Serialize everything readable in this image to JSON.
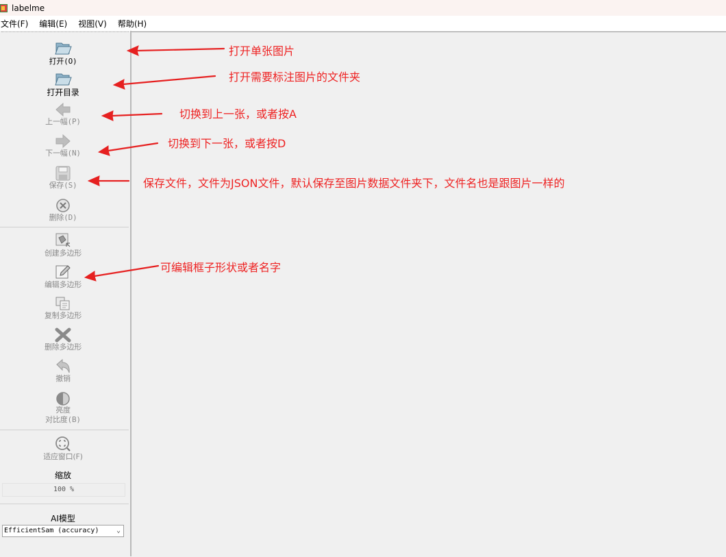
{
  "window": {
    "title": "labelme"
  },
  "menu": [
    {
      "label": "文件(F)"
    },
    {
      "label": "编辑(E)"
    },
    {
      "label": "视图(V)"
    },
    {
      "label": "帮助(H)"
    }
  ],
  "toolbar": {
    "open": {
      "label": "打开(O)",
      "icon": "folder-open-icon",
      "enabled": true
    },
    "open_dir": {
      "label": "打开目录",
      "icon": "folder-open-icon",
      "enabled": true
    },
    "prev": {
      "label": "上一幅(P)",
      "icon": "arrow-left-icon",
      "enabled": false
    },
    "next": {
      "label": "下一幅(N)",
      "icon": "arrow-right-icon",
      "enabled": false
    },
    "save": {
      "label": "保存(S)",
      "icon": "floppy-disk-icon",
      "enabled": false
    },
    "delete": {
      "label": "删除(D)",
      "icon": "circle-x-icon",
      "enabled": false
    },
    "create_polygon": {
      "label": "创建多边形",
      "icon": "polygon-create-icon",
      "enabled": false
    },
    "edit_polygon": {
      "label": "编辑多边形",
      "icon": "pencil-edit-icon",
      "enabled": false
    },
    "copy_polygon": {
      "label": "复制多边形",
      "icon": "copy-icon",
      "enabled": false
    },
    "delete_polygon": {
      "label": "删除多边形",
      "icon": "cross-delete-icon",
      "enabled": false
    },
    "undo": {
      "label": "撤销",
      "icon": "undo-icon",
      "enabled": false
    },
    "brightness": {
      "label_line1": "亮度",
      "label_line2": "对比度(B)",
      "icon": "brightness-icon",
      "enabled": false
    },
    "fit_window": {
      "label": "适应窗口(F)",
      "icon": "zoom-fit-icon",
      "enabled": false
    },
    "zoom": {
      "title": "缩放",
      "value": "100 %"
    },
    "ai_model": {
      "title": "AI模型",
      "selected": "EfficientSam (accuracy)"
    }
  },
  "annotations": [
    {
      "text": "打开单张图片"
    },
    {
      "text": "打开需要标注图片的文件夹"
    },
    {
      "text": "切换到上一张，或者按A"
    },
    {
      "text": "切换到下一张，或者按D"
    },
    {
      "text": "保存文件，文件为JSON文件，默认保存至图片数据文件夹下，文件名也是跟图片一样的"
    },
    {
      "text": "可编辑框子形状或者名字"
    }
  ],
  "colors": {
    "annotation": "#ee2222",
    "disabled_label": "#8a8a8a"
  }
}
